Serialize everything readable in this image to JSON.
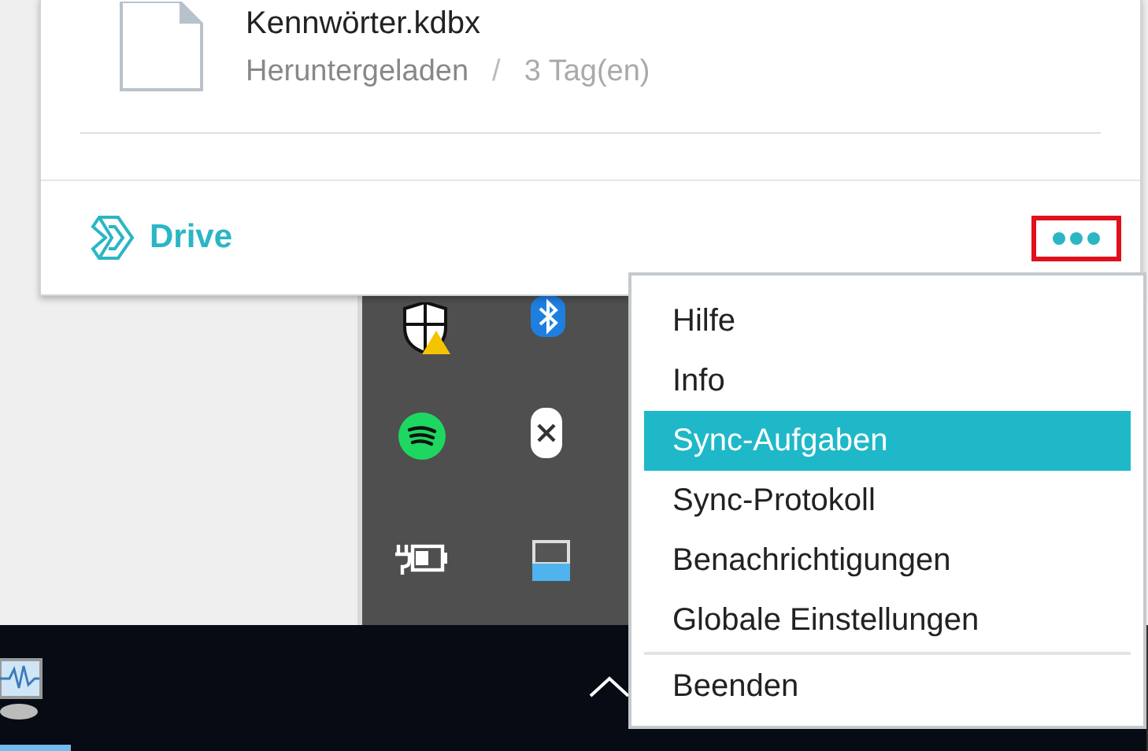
{
  "file": {
    "name": "Kennwörter.kdbx",
    "status": "Heruntergeladen",
    "separator": "/",
    "age": "3 Tag(en)"
  },
  "footer": {
    "brand": "Drive",
    "more_button": {
      "annotated": true
    }
  },
  "menu": {
    "items": [
      {
        "label": "Hilfe",
        "selected": false,
        "separated": false
      },
      {
        "label": "Info",
        "selected": false,
        "separated": false
      },
      {
        "label": "Sync-Aufgaben",
        "selected": true,
        "separated": false
      },
      {
        "label": "Sync-Protokoll",
        "selected": false,
        "separated": false
      },
      {
        "label": "Benachrichtigungen",
        "selected": false,
        "separated": false
      },
      {
        "label": "Globale Einstellungen",
        "selected": false,
        "separated": false
      },
      {
        "label": "Beenden",
        "selected": false,
        "separated": true
      }
    ]
  }
}
